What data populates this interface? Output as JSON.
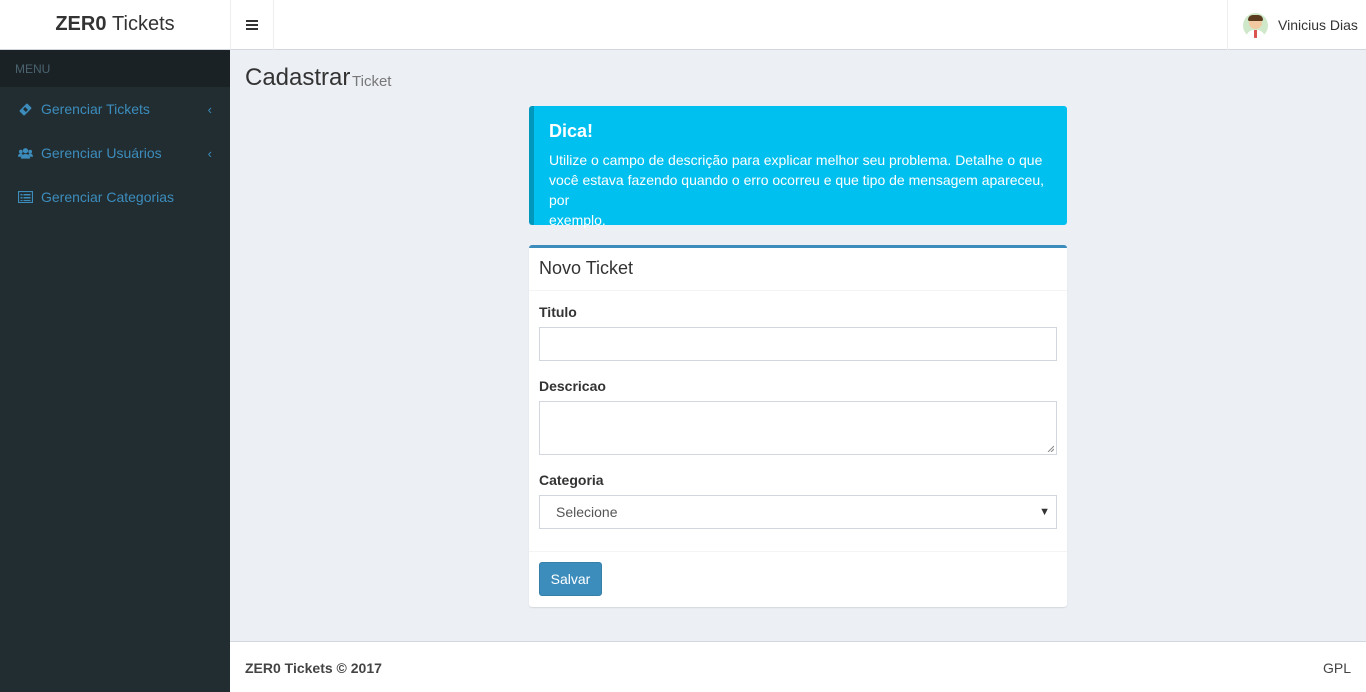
{
  "logo": {
    "bold": "ZER0",
    "rest": "Tickets"
  },
  "user": {
    "name": "Vinicius Dias"
  },
  "sidebar": {
    "header": "MENU",
    "items": [
      {
        "label": "Gerenciar Tickets",
        "icon": "ticket-icon",
        "has_children": true
      },
      {
        "label": "Gerenciar Usuários",
        "icon": "users-icon",
        "has_children": true
      },
      {
        "label": "Gerenciar Categorias",
        "icon": "list-icon",
        "has_children": false
      }
    ]
  },
  "page": {
    "title": "Cadastrar",
    "subtitle": "Ticket"
  },
  "callout": {
    "title": "Dica!",
    "line1": "Utilize o campo de descrição para explicar melhor seu problema. Detalhe o que",
    "line2": "você estava fazendo quando o erro ocorreu e que tipo de mensagem apareceu, por",
    "line3": "exemplo."
  },
  "form": {
    "title": "Novo Ticket",
    "titulo_label": "Titulo",
    "titulo_value": "",
    "descricao_label": "Descricao",
    "descricao_value": "",
    "categoria_label": "Categoria",
    "categoria_selected": "Selecione",
    "save_label": "Salvar"
  },
  "footer": {
    "left": "ZER0 Tickets © 2017",
    "right": "GPL"
  },
  "colors": {
    "primary": "#3c8dbc",
    "info": "#00c0ef",
    "sidebar": "#222d32"
  }
}
